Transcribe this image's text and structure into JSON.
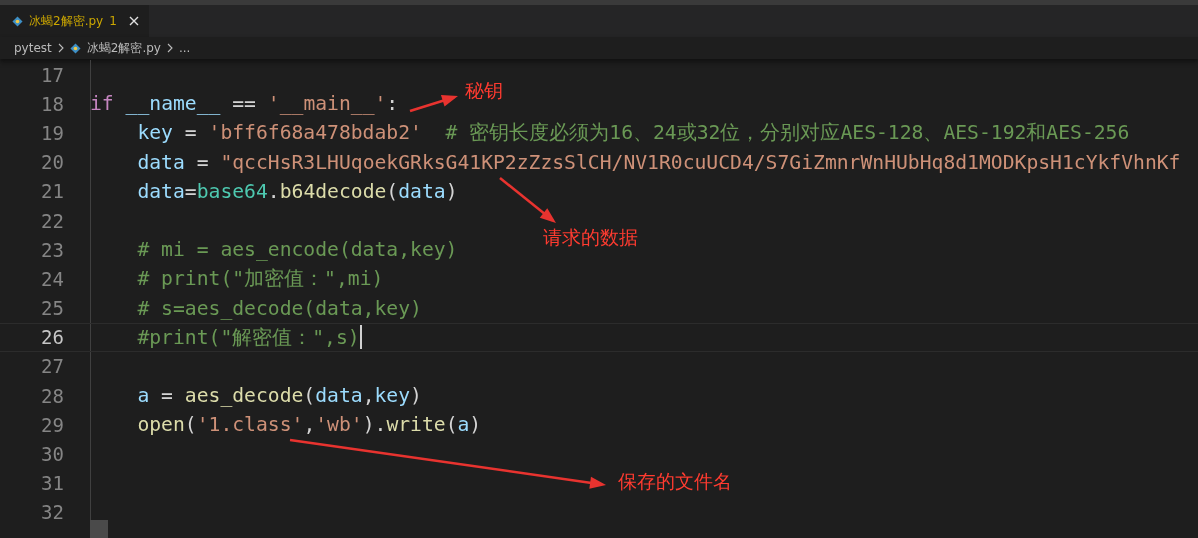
{
  "tab": {
    "label": "冰蝎2解密.py",
    "problems": "1",
    "selected": true
  },
  "breadcrumbs": [
    {
      "kind": "folder",
      "label": "pytest"
    },
    {
      "kind": "file",
      "label": "冰蝎2解密.py"
    },
    {
      "kind": "more",
      "label": "..."
    }
  ],
  "lines": [
    {
      "number": "17",
      "current": false
    },
    {
      "number": "18",
      "current": false,
      "indented": false,
      "tokens": [
        {
          "kind": "keyword",
          "text": "if"
        },
        {
          "kind": "variable",
          "text": " __name__"
        },
        {
          "kind": "plain",
          "text": " == "
        },
        {
          "kind": "string",
          "text": "'__main__'"
        },
        {
          "kind": "plain",
          "text": ":"
        }
      ]
    },
    {
      "number": "19",
      "current": false,
      "indented": true,
      "tokens": [
        {
          "kind": "variable",
          "text": "key"
        },
        {
          "kind": "plain",
          "text": " = "
        },
        {
          "kind": "string",
          "text": "'bff6f68a478bdab2'"
        },
        {
          "kind": "comment",
          "text": "  # 密钥长度必须为16、24或32位，分别对应AES-128、AES-192和AES-256"
        }
      ]
    },
    {
      "number": "20",
      "current": false,
      "indented": true,
      "tokens": [
        {
          "kind": "variable",
          "text": "data"
        },
        {
          "kind": "plain",
          "text": " = "
        },
        {
          "kind": "string",
          "text": "\"qccHsR3LHUqoekGRksG41KP2zZzsSlCH/NV1R0cuUCD4/S7GiZmnrWnHUbHq8d1MODKpsH1cYkfVhnKf"
        }
      ]
    },
    {
      "number": "21",
      "current": false,
      "indented": true,
      "tokens": [
        {
          "kind": "variable",
          "text": "data"
        },
        {
          "kind": "plain",
          "text": "="
        },
        {
          "kind": "module",
          "text": "base64"
        },
        {
          "kind": "plain",
          "text": "."
        },
        {
          "kind": "function",
          "text": "b64decode"
        },
        {
          "kind": "plain",
          "text": "("
        },
        {
          "kind": "variable",
          "text": "data"
        },
        {
          "kind": "plain",
          "text": ")"
        }
      ]
    },
    {
      "number": "22",
      "current": false
    },
    {
      "number": "23",
      "current": false,
      "indented": true,
      "tokens": [
        {
          "kind": "comment",
          "text": "# mi = aes_encode(data,key)"
        }
      ]
    },
    {
      "number": "24",
      "current": false,
      "indented": true,
      "tokens": [
        {
          "kind": "comment",
          "text": "# print(\"加密值：\",mi)"
        }
      ]
    },
    {
      "number": "25",
      "current": false,
      "indented": true,
      "tokens": [
        {
          "kind": "comment",
          "text": "# s=aes_decode(data,key)"
        }
      ]
    },
    {
      "number": "26",
      "current": true,
      "indented": true,
      "tokens": [
        {
          "kind": "comment",
          "text": "#print(\"解密值：\",s)"
        }
      ]
    },
    {
      "number": "27",
      "current": false
    },
    {
      "number": "28",
      "current": false,
      "indented": true,
      "tokens": [
        {
          "kind": "variable",
          "text": "a"
        },
        {
          "kind": "plain",
          "text": " = "
        },
        {
          "kind": "function",
          "text": "aes_decode"
        },
        {
          "kind": "plain",
          "text": "("
        },
        {
          "kind": "variable",
          "text": "data"
        },
        {
          "kind": "plain",
          "text": ","
        },
        {
          "kind": "variable",
          "text": "key"
        },
        {
          "kind": "plain",
          "text": ")"
        }
      ]
    },
    {
      "number": "29",
      "current": false,
      "indented": true,
      "tokens": [
        {
          "kind": "function",
          "text": "open"
        },
        {
          "kind": "plain",
          "text": "("
        },
        {
          "kind": "string",
          "text": "'1.class'"
        },
        {
          "kind": "plain",
          "text": ","
        },
        {
          "kind": "string",
          "text": "'wb'"
        },
        {
          "kind": "plain",
          "text": ")."
        },
        {
          "kind": "function",
          "text": "write"
        },
        {
          "kind": "plain",
          "text": "("
        },
        {
          "kind": "variable",
          "text": "a"
        },
        {
          "kind": "plain",
          "text": ")"
        }
      ]
    },
    {
      "number": "30",
      "current": false
    },
    {
      "number": "31",
      "current": false
    },
    {
      "number": "32",
      "current": false
    }
  ],
  "annotations": [
    {
      "label": "秘钥"
    },
    {
      "label": "请求的数据"
    },
    {
      "label": "保存的文件名"
    }
  ]
}
